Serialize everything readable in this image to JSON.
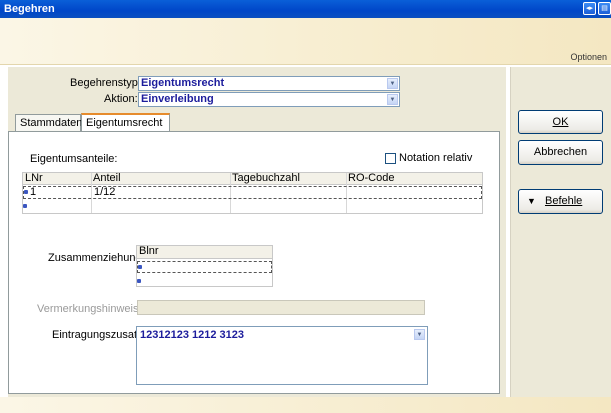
{
  "window": {
    "title": "Begehren"
  },
  "header": {
    "options_label": "Optionen"
  },
  "form": {
    "begehrenstyp_label": "Begehrenstyp:",
    "begehrenstyp_value": "Eigentumsrecht",
    "aktion_label": "Aktion:",
    "aktion_value": "Einverleibung"
  },
  "tabs": [
    {
      "label": "Stammdaten"
    },
    {
      "label": "Eigentumsrecht"
    }
  ],
  "eigentum": {
    "section_label": "Eigentumsanteile:",
    "notation_label": "Notation relativ",
    "columns": [
      "LNr",
      "Anteil",
      "Tagebuchzahl",
      "RO-Code"
    ],
    "rows": [
      {
        "lnr": "1",
        "anteil": "1/12",
        "tagebuchzahl": "",
        "ro_code": ""
      }
    ]
  },
  "zusammen": {
    "label": "Zusammenziehung:",
    "column": "Blnr"
  },
  "vermerk": {
    "label": "Vermerkungshinweis:"
  },
  "eintragung": {
    "label": "Eintragungszusatz:",
    "value": "12312123 1212 3123"
  },
  "buttons": {
    "ok": "OK",
    "cancel": "Abbrechen",
    "befehle": "Befehle"
  },
  "colors": {
    "title_blue": "#0046c8",
    "value_blue": "#1c1c9c",
    "tab_accent": "#e68b2c"
  }
}
